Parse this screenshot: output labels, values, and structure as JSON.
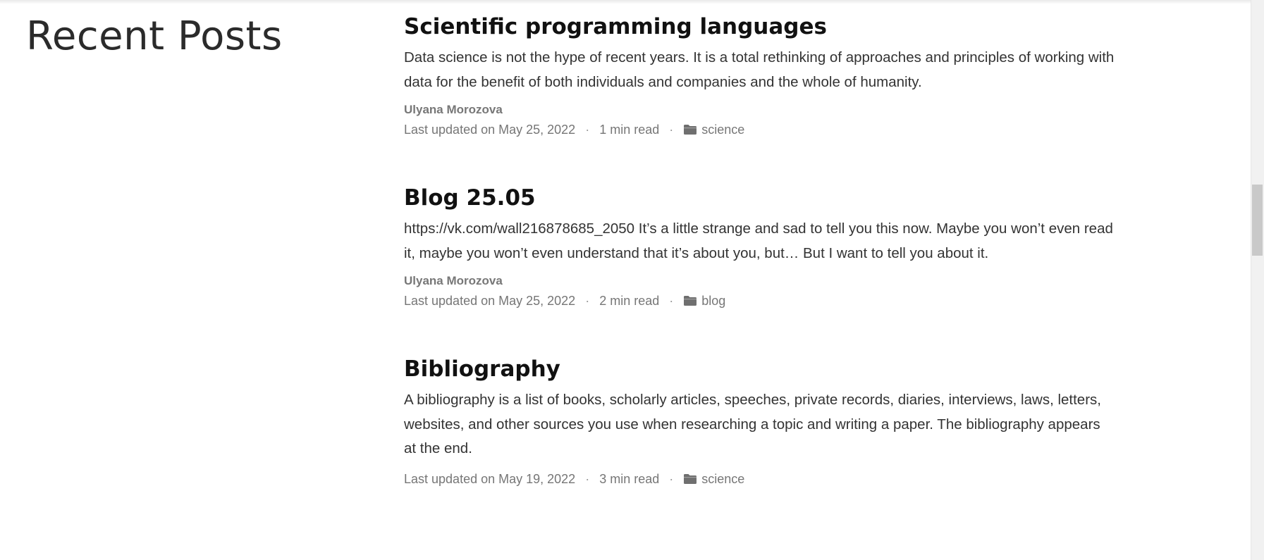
{
  "section": {
    "title": "Recent Posts"
  },
  "posts": [
    {
      "title": "Scientific programming languages",
      "summary": "Data science is not the hype of recent years. It is a total rethinking of approaches and principles of working with data for the benefit of both individuals and companies and the whole of humanity.",
      "author": "Ulyana Morozova",
      "updated": "Last updated on May 25, 2022",
      "read_time": "1 min read",
      "category": "science",
      "separator": "·"
    },
    {
      "title": "Blog 25.05",
      "summary": "https://vk.com/wall216878685_2050 It’s a little strange and sad to tell you this now. Maybe you won’t even read it, maybe you won’t even understand that it’s about you, but… But I want to tell you about it.",
      "author": "Ulyana Morozova",
      "updated": "Last updated on May 25, 2022",
      "read_time": "2 min read",
      "category": "blog",
      "separator": "·"
    },
    {
      "title": "Bibliography",
      "summary": "A bibliography is a list of books, scholarly articles, speeches, private records, diaries, interviews, laws, letters, websites, and other sources you use when researching a topic and writing a paper. The bibliography appears at the end.",
      "updated": "Last updated on May 19, 2022",
      "read_time": "3 min read",
      "category": "science",
      "separator": "·"
    }
  ],
  "icons": {
    "category": "folder-icon"
  },
  "colors": {
    "title": "#111111",
    "body_text": "#333333",
    "meta_text": "#767676"
  }
}
